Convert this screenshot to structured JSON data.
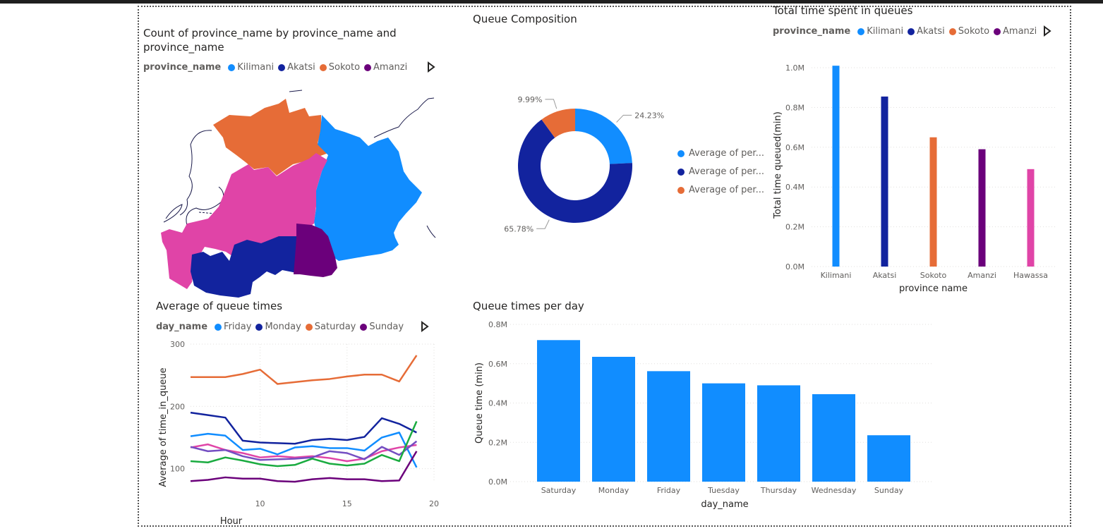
{
  "colors": {
    "Kilimani": "#118DFF",
    "Akatsi": "#12239E",
    "Sokoto": "#E66C37",
    "Amanzi": "#6B007B",
    "Hawassa": "#E044A7",
    "green": "#1AAB40"
  },
  "map_visual": {
    "title_line1": "Count of province_name by province_name and",
    "title_line2": "province_name",
    "legend_title": "province_name",
    "legend": [
      "Kilimani",
      "Akatsi",
      "Sokoto",
      "Amanzi"
    ]
  },
  "bar_visual": {
    "title": "Total time spent in queues",
    "legend_title": "province_name",
    "legend": [
      "Kilimani",
      "Akatsi",
      "Sokoto",
      "Amanzi"
    ]
  },
  "donut_visual": {
    "title": "Queue Composition",
    "legend": [
      "Average of per...",
      "Average of per...",
      "Average of per..."
    ]
  },
  "line_visual": {
    "title": "Average of queue times",
    "legend_title": "day_name",
    "legend": [
      "Friday",
      "Monday",
      "Saturday",
      "Sunday"
    ]
  },
  "day_visual": {
    "title": "Queue times per day"
  },
  "chart_data": [
    {
      "id": "donut",
      "type": "pie",
      "title": "Queue Composition",
      "slices": [
        {
          "label": "Average of per...",
          "value": 24.23,
          "display": "24.23%",
          "color": "#118DFF"
        },
        {
          "label": "Average of per...",
          "value": 65.78,
          "display": "65.78%",
          "color": "#12239E"
        },
        {
          "label": "Average of per...",
          "value": 9.99,
          "display": "9.99%",
          "color": "#E66C37"
        }
      ]
    },
    {
      "id": "province_bar",
      "type": "bar",
      "title": "Total time spent in queues",
      "xlabel": "province name",
      "ylabel": "Total time queued(min)",
      "categories": [
        "Kilimani",
        "Akatsi",
        "Sokoto",
        "Amanzi",
        "Hawassa"
      ],
      "values": [
        1010000,
        855000,
        650000,
        590000,
        490000
      ],
      "colors": [
        "#118DFF",
        "#12239E",
        "#E66C37",
        "#6B007B",
        "#E044A7"
      ],
      "ylim": [
        0,
        1000000
      ],
      "yticks": [
        0,
        200000,
        400000,
        600000,
        800000,
        1000000
      ],
      "ytick_labels": [
        "0.0M",
        "0.2M",
        "0.4M",
        "0.6M",
        "0.8M",
        "1.0M"
      ]
    },
    {
      "id": "hour_line",
      "type": "line",
      "title": "Average of queue times",
      "xlabel": "Hour",
      "ylabel": "Average of time_in_queue",
      "xlim": [
        6,
        20
      ],
      "ylim": [
        78,
        300
      ],
      "xticks": [
        10,
        15,
        20
      ],
      "yticks": [
        100,
        200,
        300
      ],
      "x": [
        6,
        7,
        8,
        9,
        10,
        11,
        12,
        13,
        14,
        15,
        16,
        17,
        18,
        19
      ],
      "series": [
        {
          "name": "Saturday",
          "color": "#E66C37",
          "values": [
            247,
            247,
            247,
            252,
            259,
            236,
            239,
            242,
            244,
            248,
            251,
            251,
            240,
            282
          ]
        },
        {
          "name": "Monday",
          "color": "#12239E",
          "values": [
            190,
            186,
            182,
            145,
            142,
            141,
            140,
            146,
            148,
            146,
            151,
            181,
            172,
            158
          ]
        },
        {
          "name": "Friday",
          "color": "#118DFF",
          "values": [
            152,
            156,
            153,
            130,
            132,
            123,
            134,
            136,
            133,
            133,
            129,
            150,
            158,
            102
          ]
        },
        {
          "name": "",
          "color": "#E044A7",
          "values": [
            134,
            139,
            130,
            125,
            118,
            120,
            118,
            120,
            117,
            112,
            116,
            128,
            134,
            138
          ]
        },
        {
          "name": "",
          "color": "#744EC2",
          "values": [
            135,
            128,
            130,
            120,
            114,
            115,
            116,
            118,
            128,
            125,
            115,
            135,
            122,
            144
          ]
        },
        {
          "name": "",
          "color": "#1AAB40",
          "values": [
            112,
            110,
            118,
            113,
            107,
            104,
            106,
            116,
            108,
            105,
            108,
            122,
            112,
            176
          ]
        },
        {
          "name": "Sunday",
          "color": "#6B007B",
          "values": [
            80,
            82,
            86,
            84,
            84,
            80,
            79,
            83,
            85,
            83,
            83,
            80,
            81,
            128
          ]
        }
      ]
    },
    {
      "id": "day_bar",
      "type": "bar",
      "title": "Queue times per day",
      "xlabel": "day_name",
      "ylabel": "Queue time (min)",
      "categories": [
        "Saturday",
        "Monday",
        "Friday",
        "Tuesday",
        "Thursday",
        "Wednesday",
        "Sunday"
      ],
      "values": [
        720000,
        635000,
        562000,
        500000,
        490000,
        445000,
        236000
      ],
      "color": "#118DFF",
      "ylim": [
        0,
        800000
      ],
      "yticks": [
        0,
        200000,
        400000,
        600000,
        800000
      ],
      "ytick_labels": [
        "0.0M",
        "0.2M",
        "0.4M",
        "0.6M",
        "0.8M"
      ]
    }
  ]
}
